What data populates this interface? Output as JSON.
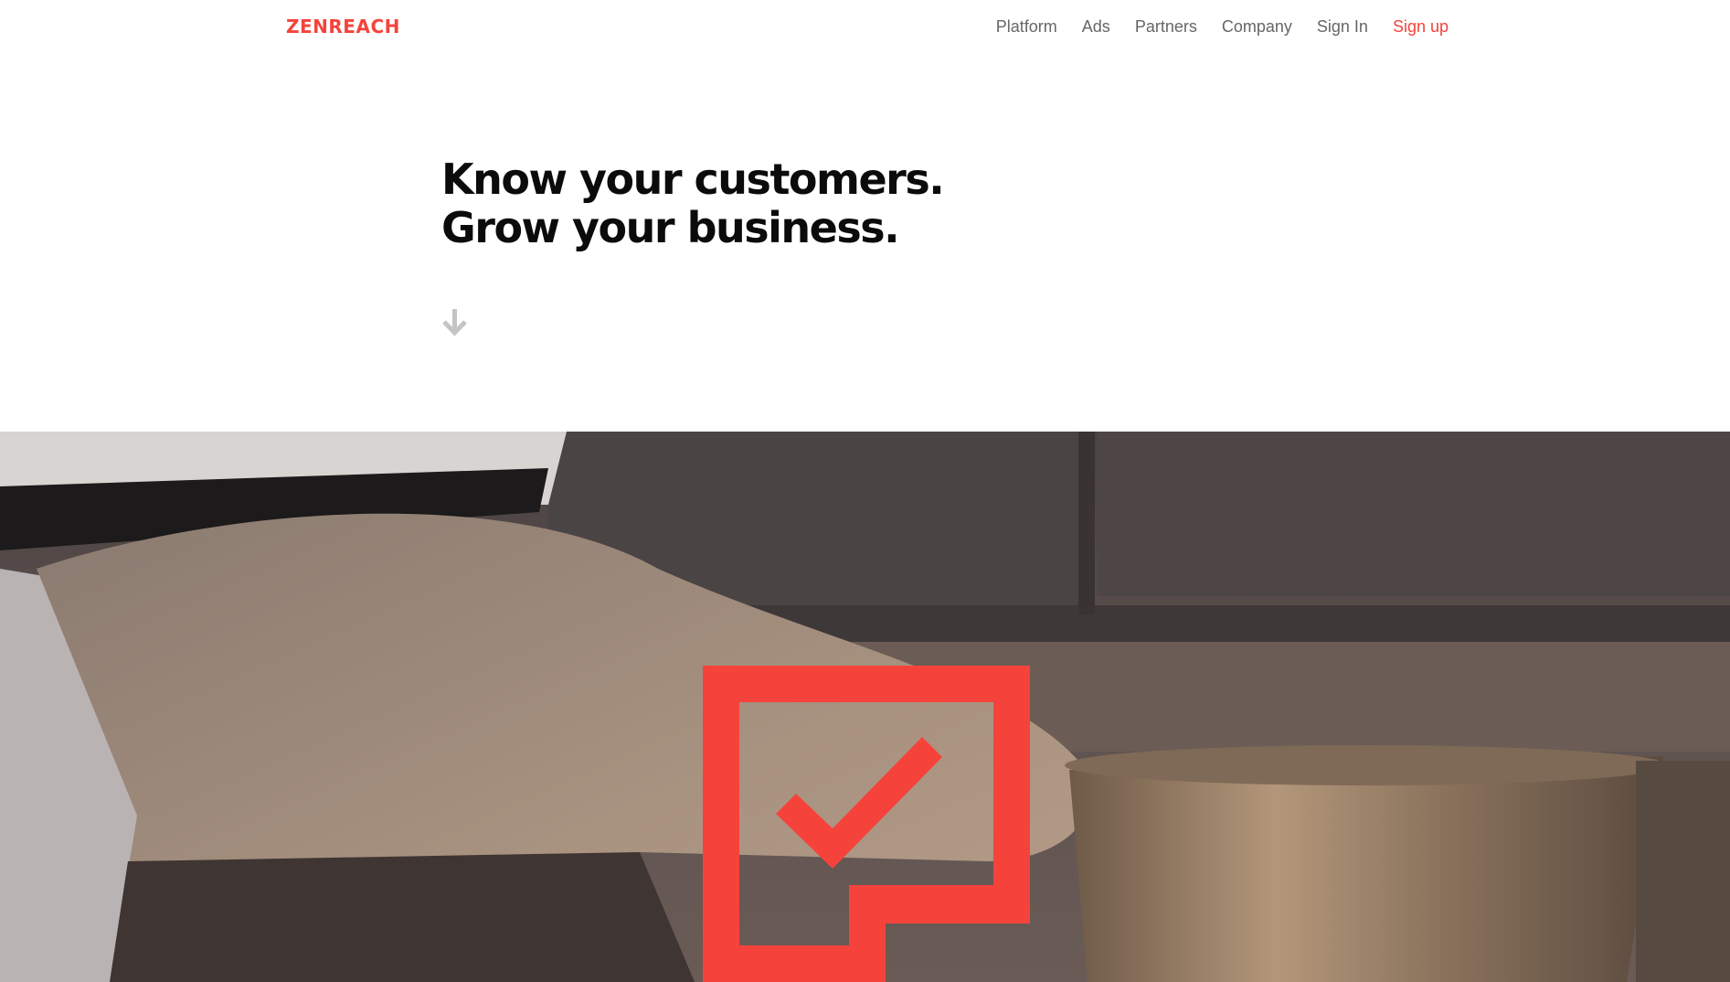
{
  "header": {
    "logo": "ZENREACH",
    "nav": {
      "platform": "Platform",
      "ads": "Ads",
      "partners": "Partners",
      "company": "Company",
      "sign_in": "Sign In",
      "sign_up": "Sign up"
    }
  },
  "hero": {
    "headline_line1": "Know your customers.",
    "headline_line2": "Grow your business.",
    "scroll_icon": "arrow-down-icon"
  },
  "media": {
    "description_icon": "checkbox-logo-icon",
    "photo": "chef-in-kitchen-photo"
  },
  "colors": {
    "brand_red": "#f5433b",
    "nav_text": "#666666",
    "heading_text": "#0b0b0b",
    "arrow_gray": "#c4c4c4"
  }
}
